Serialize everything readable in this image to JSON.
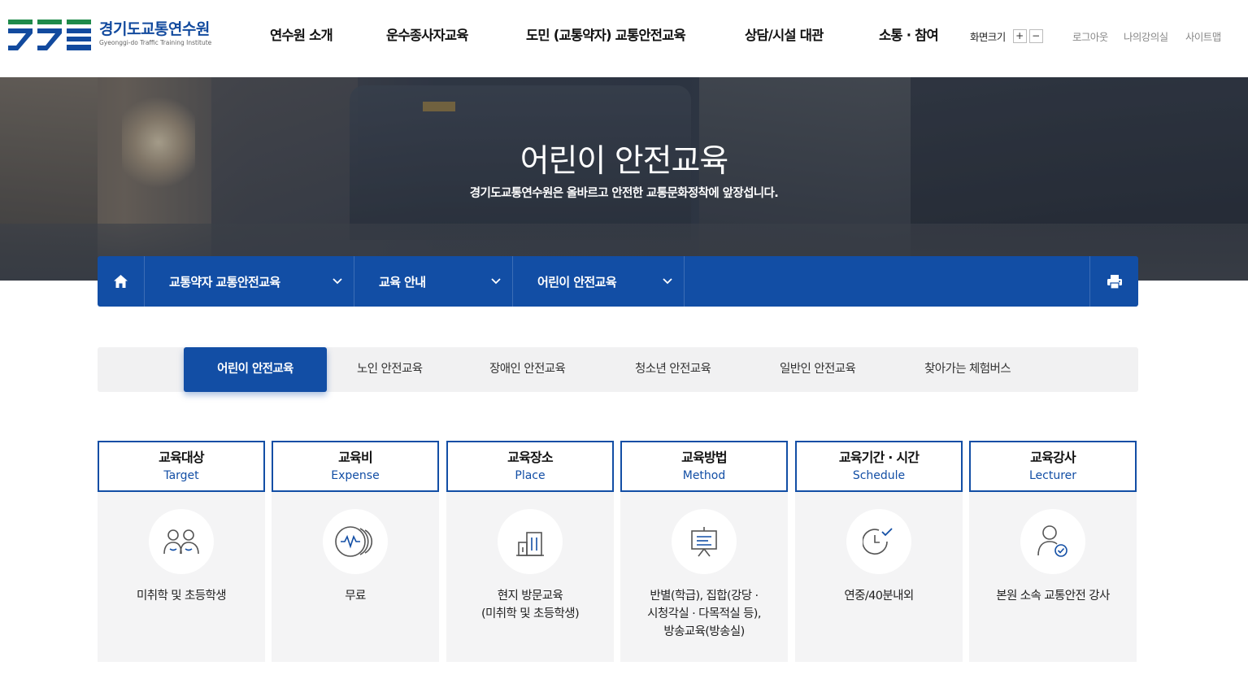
{
  "header": {
    "logo": {
      "name_ko": "경기도교통연수원",
      "name_en": "Gyeonggi-do Traffic Training Institute"
    },
    "gnb": [
      "연수원 소개",
      "운수종사자교육",
      "도민 (교통약자) 교통안전교육",
      "상담/시설 대관",
      "소통 · 참여"
    ],
    "font_size": {
      "label": "화면크기",
      "plus": "+",
      "minus": "−"
    },
    "util": [
      "로그아웃",
      "나의강의실",
      "사이트맵"
    ]
  },
  "hero": {
    "title": "어린이 안전교육",
    "subtitle": "경기도교통연수원은 올바르고 안전한 교통문화정착에 앞장섭니다."
  },
  "location": {
    "home_icon": "home-icon",
    "items": [
      "교통약자 교통안전교육",
      "교육 안내",
      "어린이 안전교육"
    ],
    "print_icon": "print-icon"
  },
  "tabs": [
    "어린이 안전교육",
    "노인 안전교육",
    "장애인 안전교육",
    "청소년 안전교육",
    "일반인 안전교육",
    "찾아가는 체험버스"
  ],
  "active_tab": 0,
  "cards": [
    {
      "title": "교육대상",
      "en": "Target",
      "icon": "people-icon",
      "desc": "미취학 및 초등학생"
    },
    {
      "title": "교육비",
      "en": "Expense",
      "icon": "coin-icon",
      "desc": "무료"
    },
    {
      "title": "교육장소",
      "en": "Place",
      "icon": "building-icon",
      "desc": "현지 방문교육\n(미취학 및 초등학생)"
    },
    {
      "title": "교육방법",
      "en": "Method",
      "icon": "presentation-icon",
      "desc": "반별(학급), 집합(강당 ·\n시청각실 · 다목적실 등),\n방송교육(방송실)"
    },
    {
      "title": "교육기간 · 시간",
      "en": "Schedule",
      "icon": "clock-check-icon",
      "desc": "연중/40분내외"
    },
    {
      "title": "교육강사",
      "en": "Lecturer",
      "icon": "lecturer-check-icon",
      "desc": "본원 소속 교통안전 강사"
    }
  ],
  "colors": {
    "brand_blue": "#124ea5",
    "brand_green": "#1e8a4a",
    "card_bg": "#f4f4f5",
    "tab_bg": "#f1f1f2"
  }
}
